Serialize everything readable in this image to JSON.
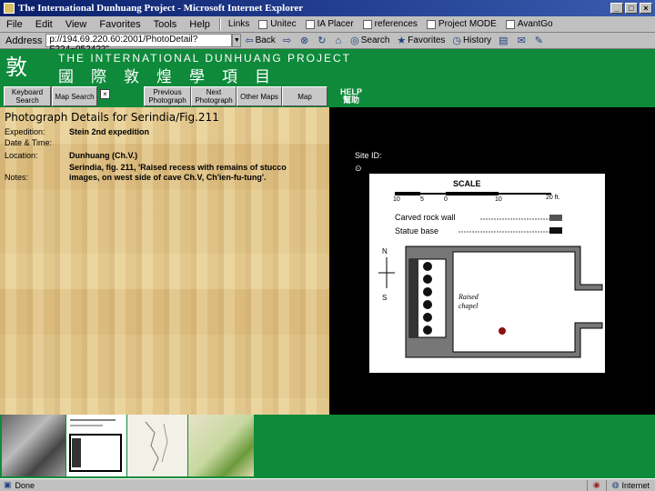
{
  "window": {
    "title": "The International Dunhuang Project - Microsoft Internet Explorer",
    "controls": [
      "_",
      "□",
      "×"
    ]
  },
  "menu": {
    "items": [
      "File",
      "Edit",
      "View",
      "Favorites",
      "Tools",
      "Help"
    ]
  },
  "links": [
    "Links",
    "Unitec",
    "IA Placer",
    "references",
    "Project MODE",
    "AvantGo"
  ],
  "address": {
    "label": "Address",
    "url": "p://194.69.220.60:2001/PhotoDetail?F224~0524?2\""
  },
  "toolbar": [
    "Back",
    "Search",
    "Favorites",
    "History"
  ],
  "site": {
    "logo": "敦",
    "title_en": "THE INTERNATIONAL DUNHUANG PROJECT",
    "title_zh": "國際敦煌學項目"
  },
  "nav": {
    "keyword_search": "Keyboard Search",
    "map_search": "Map Search",
    "small_box": "×",
    "previous": "Previous Photograph",
    "next": "Next Photograph",
    "other_maps": "Other Maps",
    "map": "Map",
    "help": "HELP",
    "help_zh": "幫助"
  },
  "details": {
    "heading": "Photograph Details for Serindia/Fig.211",
    "expedition_label": "Expedition:",
    "expedition_value": "Stein 2nd expedition",
    "date_label": "Date & Time:",
    "date_value": "",
    "location_label": "Location:",
    "location_value": "Dunhuang (Ch.V.)",
    "notes_label": "Notes:",
    "notes_value": "Serindia, fig. 211, 'Raised recess with remains of stucco images, on west side of cave Ch.V, Ch'ien-fu-tung'."
  },
  "site_id": {
    "label": "Site ID:",
    "marker": "⊙"
  },
  "plan": {
    "scale_title": "SCALE",
    "scale_ticks": [
      "10",
      "5",
      "0",
      "10",
      "20 ft."
    ],
    "legend_rock": "Carved rock wall",
    "legend_statue": "Statue base",
    "north": "N",
    "south": "S",
    "chapel_label_1": "Raised",
    "chapel_label_2": "chapel"
  },
  "status": {
    "done": "Done",
    "zone": "Internet"
  },
  "colors": {
    "header_green": "#0e8a3a",
    "paper_tan": "#e2c98e",
    "titlebar_blue": "#0a1f6b"
  }
}
